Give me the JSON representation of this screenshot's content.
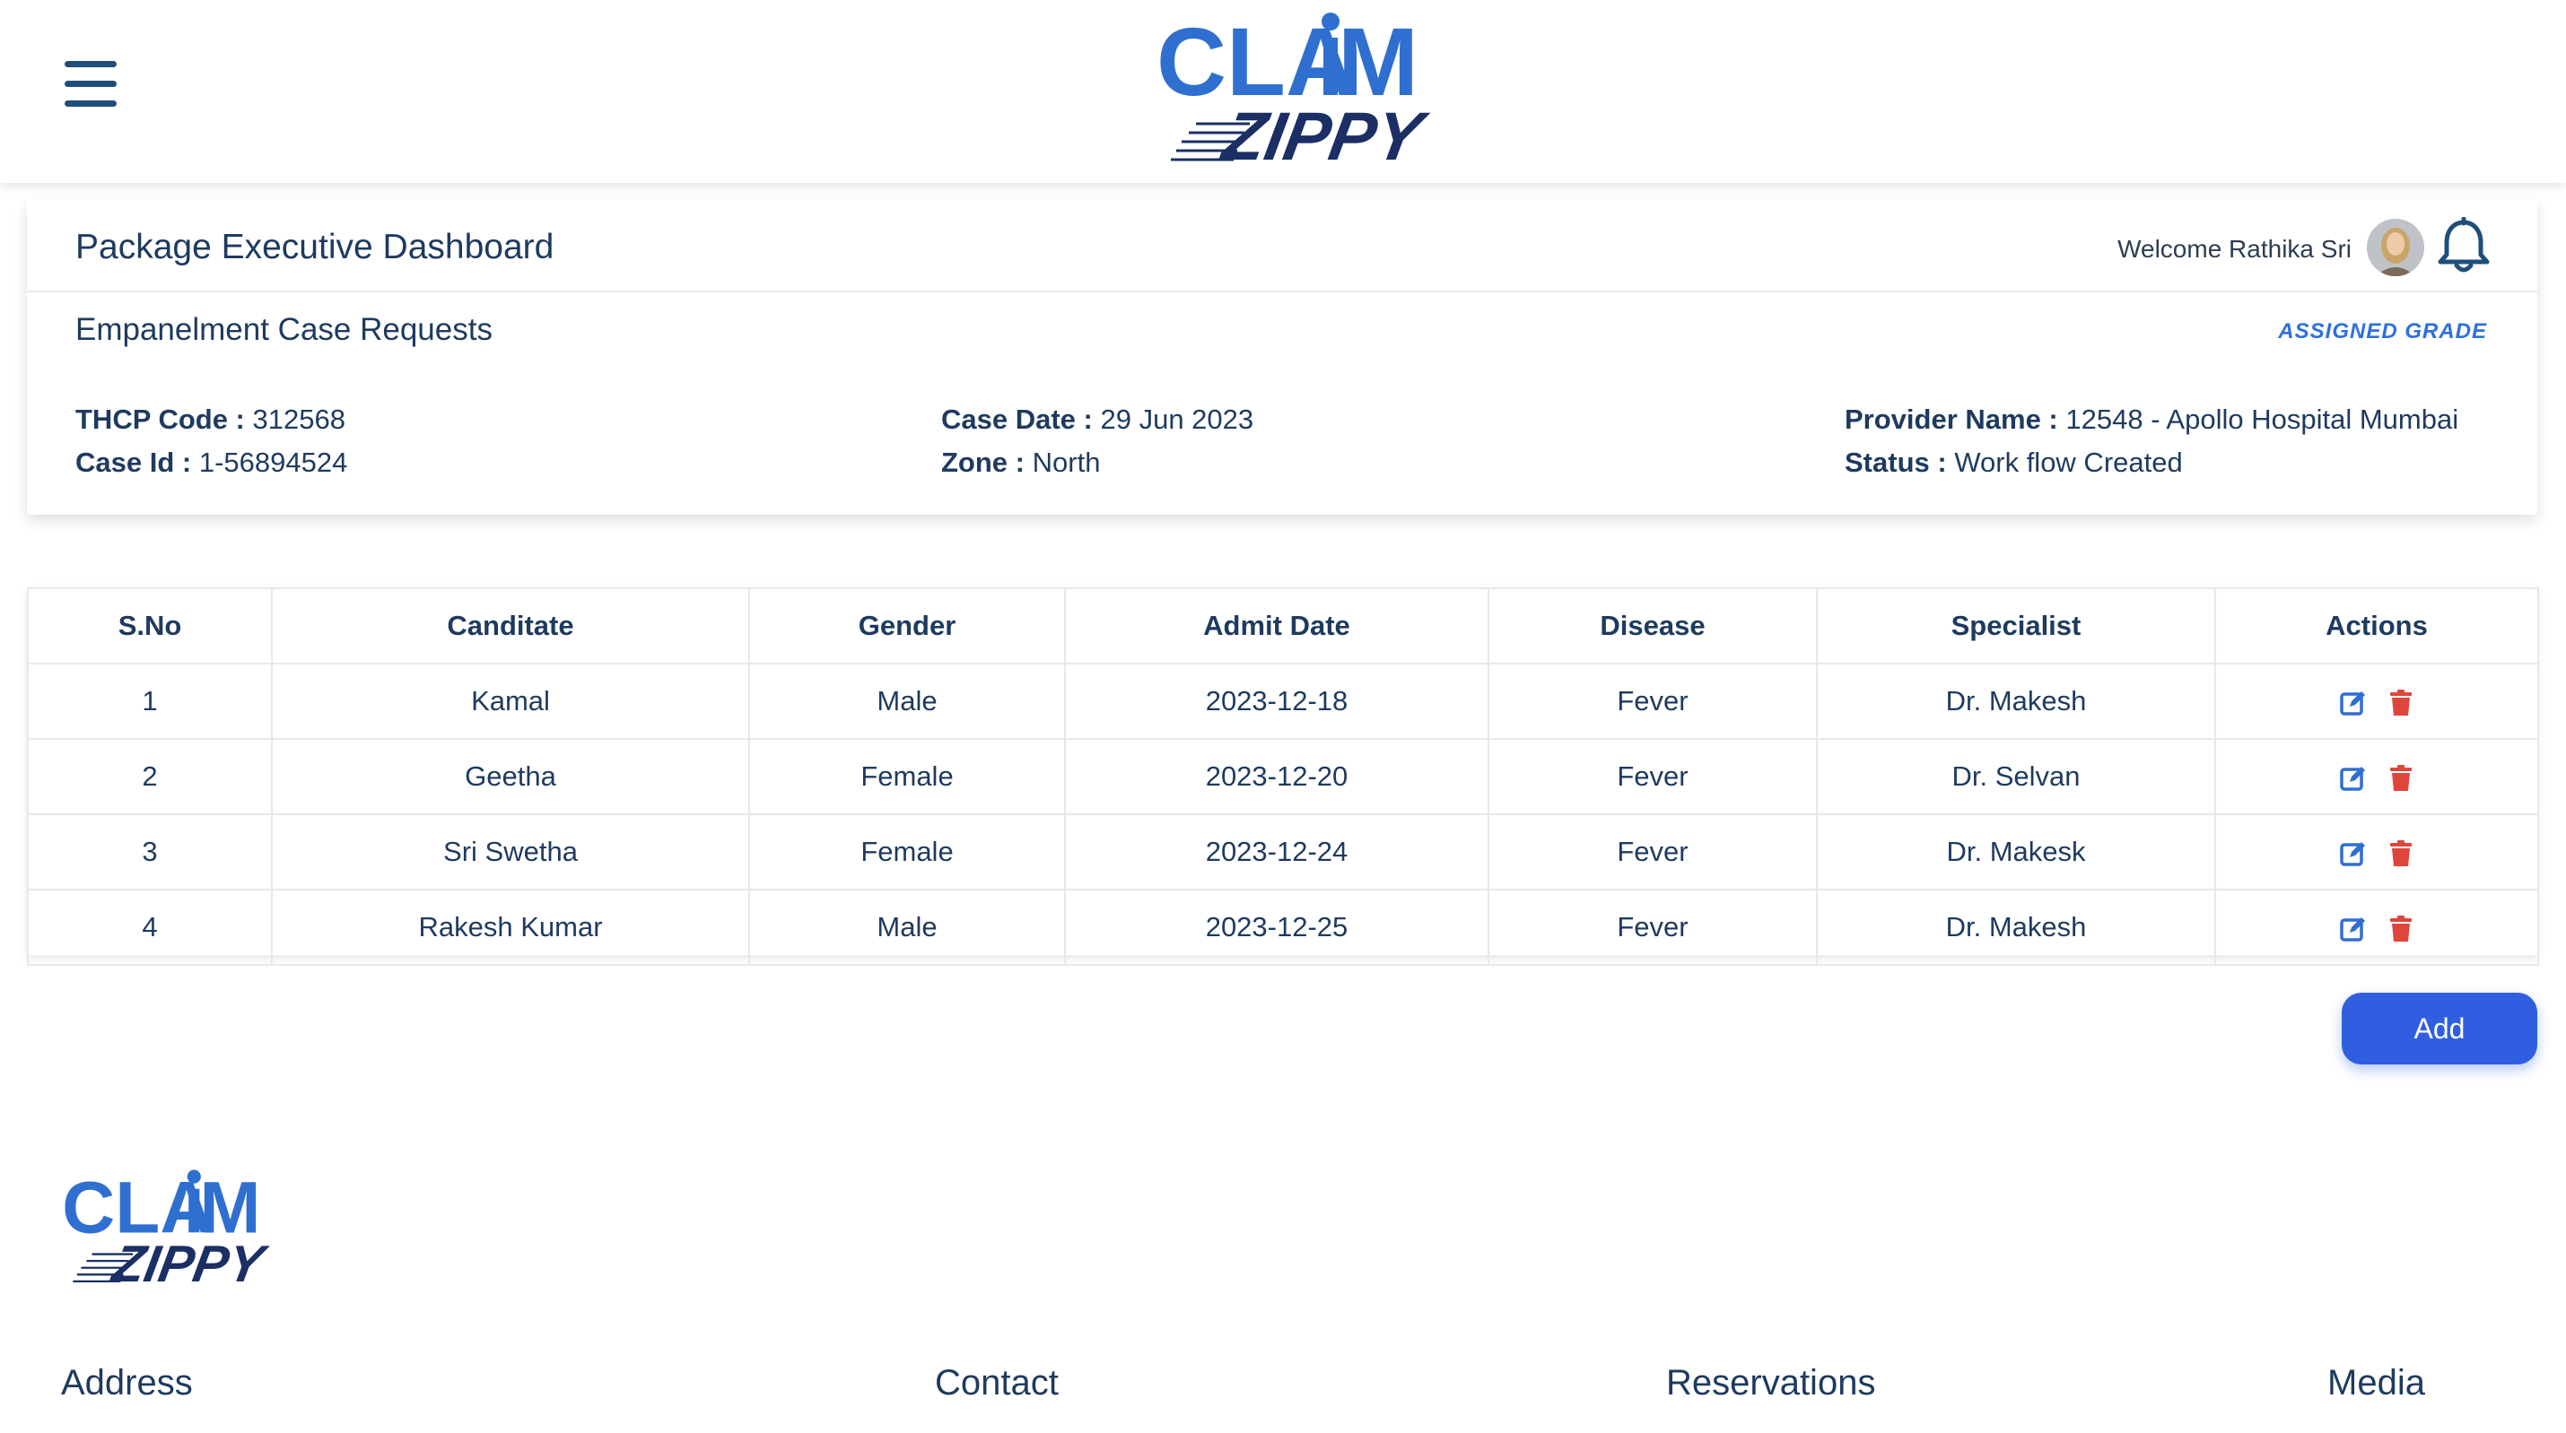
{
  "brand": {
    "line1": "CLAIM",
    "line2": "ZIPPY",
    "primary": "#2f6fd0",
    "dark": "#1b2f64"
  },
  "header": {
    "menu_icon": "hamburger-menu-icon"
  },
  "dashboard": {
    "title": "Package Executive Dashboard",
    "welcome": "Welcome Rathika Sri",
    "bell_icon": "bell-icon",
    "section_title": "Empanelment Case Requests",
    "grade_link": "ASSIGNED GRADE",
    "fields": {
      "thcp_label": "THCP Code :",
      "thcp_value": "312568",
      "case_id_label": "Case Id :",
      "case_id_value": "1-56894524",
      "case_date_label": "Case Date :",
      "case_date_value": "29 Jun 2023",
      "zone_label": "Zone :",
      "zone_value": "North",
      "provider_label": "Provider Name :",
      "provider_value": "12548 - Apollo Hospital Mumbai",
      "status_label": "Status :",
      "status_value": "Work flow Created"
    }
  },
  "table": {
    "headers": [
      "S.No",
      "Canditate",
      "Gender",
      "Admit Date",
      "Disease",
      "Specialist",
      "Actions"
    ],
    "rows": [
      [
        "1",
        "Kamal",
        "Male",
        "2023-12-18",
        "Fever",
        "Dr. Makesh"
      ],
      [
        "2",
        "Geetha",
        "Female",
        "2023-12-20",
        "Fever",
        "Dr. Selvan"
      ],
      [
        "3",
        "Sri Swetha",
        "Female",
        "2023-12-24",
        "Fever",
        "Dr. Makesk"
      ],
      [
        "4",
        "Rakesh Kumar",
        "Male",
        "2023-12-25",
        "Fever",
        "Dr. Makesh"
      ]
    ],
    "edit_color": "#2f6fd0",
    "delete_color": "#e0453a"
  },
  "add_button": "Add",
  "footer": {
    "address": "Address",
    "contact": "Contact",
    "reservations": "Reservations",
    "media": "Media"
  }
}
